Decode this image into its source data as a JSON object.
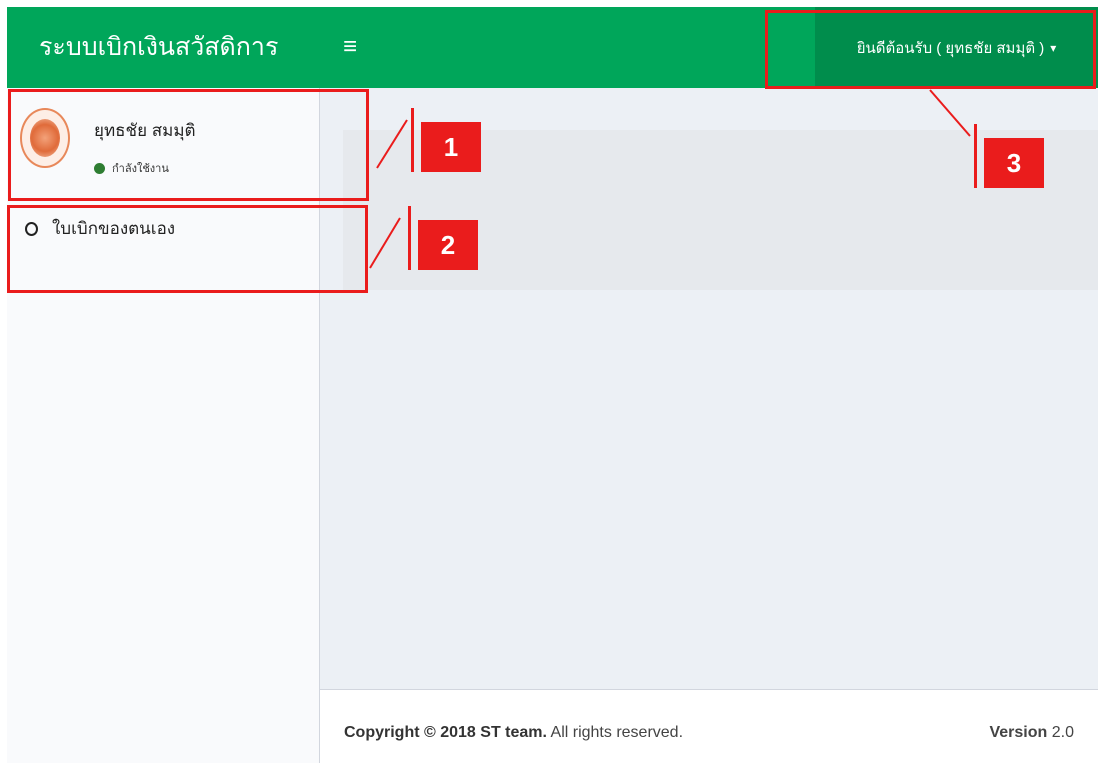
{
  "app": {
    "title": "ระบบเบิกเงินสวัสดิการ",
    "menu_icon": "hamburger-icon"
  },
  "header": {
    "welcome_label": "ยินดีต้อนรับ ( ยุทธชัย สมมุติ )",
    "caret_icon": "caret-down-icon"
  },
  "sidebar": {
    "user": {
      "name": "ยุทธชัย สมมุติ",
      "status": "กำลังใช้งาน",
      "status_color": "#2e7d32"
    },
    "items": [
      {
        "label": "ใบเบิกของตนเอง",
        "icon": "circle-icon"
      }
    ]
  },
  "footer": {
    "copyright_prefix": "Copyright © 2018 ST team.",
    "copyright_suffix": "All rights reserved.",
    "version_label": "Version",
    "version_number": "2.0"
  },
  "annotations": [
    {
      "number": "1"
    },
    {
      "number": "2"
    },
    {
      "number": "3"
    }
  ],
  "colors": {
    "accent": "#00a65a",
    "accent_dark": "#008d4c",
    "annotation": "#ea1c1c"
  }
}
